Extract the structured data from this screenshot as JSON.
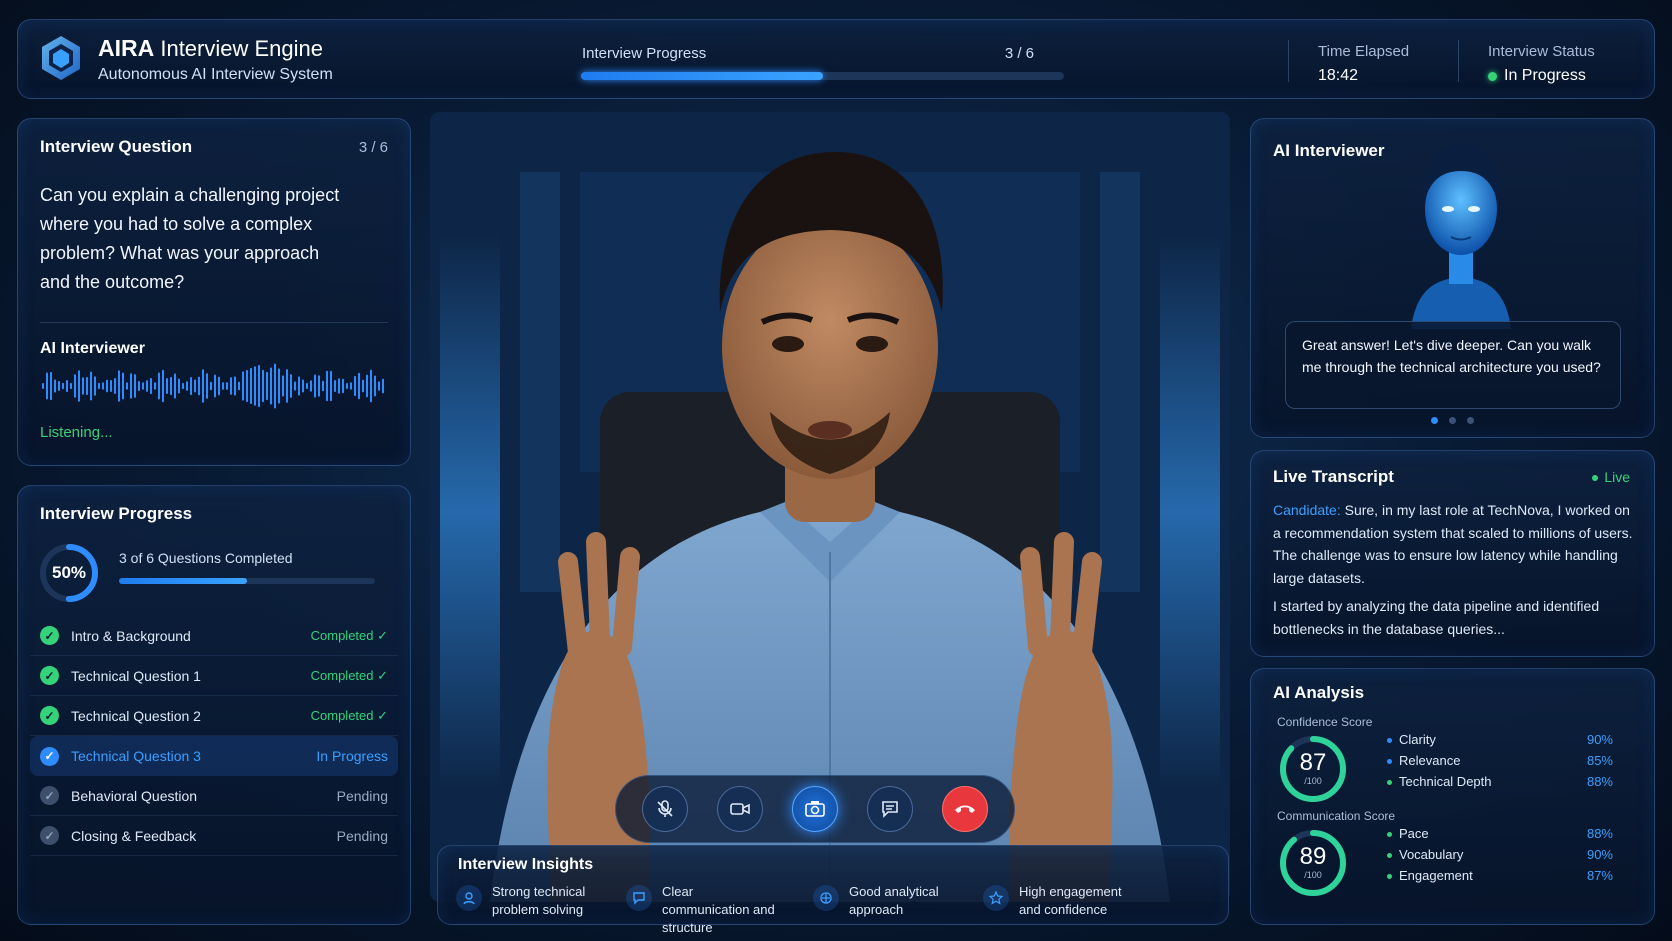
{
  "header": {
    "brand_strong": "AIRA",
    "brand_rest": " Interview Engine",
    "subtitle": "Autonomous AI Interview System",
    "progress_label": "Interview Progress",
    "progress_count": "3 / 6",
    "progress_fraction": 0.5,
    "time_label": "Time Elapsed",
    "time_value": "18:42",
    "status_label": "Interview Status",
    "status_value": "In Progress"
  },
  "question": {
    "title": "Interview Question",
    "count": "3 / 6",
    "text": "Can you explain a challenging project where you had to solve a complex problem? What was your approach and the outcome?",
    "ai_label": "AI Interviewer",
    "listening": "Listening..."
  },
  "progress": {
    "title": "Interview Progress",
    "percent": "50%",
    "percent_value": 50,
    "summary": "3 of 6 Questions Completed",
    "steps": [
      {
        "name": "Intro & Background",
        "status": "Completed ✓",
        "state": "done"
      },
      {
        "name": "Technical Question 1",
        "status": "Completed ✓",
        "state": "done"
      },
      {
        "name": "Technical Question 2",
        "status": "Completed ✓",
        "state": "done"
      },
      {
        "name": "Technical Question 3",
        "status": "In Progress",
        "state": "prog"
      },
      {
        "name": "Behavioral Question",
        "status": "Pending",
        "state": "pend"
      },
      {
        "name": "Closing & Feedback",
        "status": "Pending",
        "state": "pend"
      }
    ]
  },
  "controls": {
    "icons": [
      "microphone-icon",
      "video-camera-icon",
      "camera-capture-icon",
      "chat-icon",
      "end-call-icon"
    ],
    "end_color": "#e8383d",
    "accent_color": "#2f8cff"
  },
  "insights": {
    "title": "Interview Insights",
    "items": [
      {
        "text": "Strong technical problem solving",
        "icon": "user-icon"
      },
      {
        "text": "Clear communication and structure",
        "icon": "chat-icon"
      },
      {
        "text": "Good analytical approach",
        "icon": "brain-icon"
      },
      {
        "text": "High engagement and confidence",
        "icon": "star-icon"
      }
    ]
  },
  "ai_interviewer": {
    "title": "AI Interviewer",
    "message": "Great answer! Let's dive deeper. Can you walk me through the technical architecture you used?",
    "active_dot": 0
  },
  "transcript": {
    "title": "Live Transcript",
    "live": "Live",
    "speaker": "Candidate:",
    "para1": "Sure, in my last role at TechNova, I worked on a recommendation system that scaled to millions of users. The challenge was to ensure low latency while handling large datasets.",
    "para2": "I started by analyzing the data pipeline and identified bottlenecks in the database queries..."
  },
  "analysis": {
    "title": "AI Analysis",
    "confidence": {
      "label": "Confidence Score",
      "score": "87",
      "score_value": 87,
      "denominator": "/100",
      "metrics": [
        {
          "name": "Clarity",
          "value": "90%",
          "color": "#2f8cff"
        },
        {
          "name": "Relevance",
          "value": "85%",
          "color": "#2f8cff"
        },
        {
          "name": "Technical Depth",
          "value": "88%",
          "color": "#35d27a"
        }
      ]
    },
    "communication": {
      "label": "Communication Score",
      "score": "89",
      "score_value": 89,
      "denominator": "/100",
      "metrics": [
        {
          "name": "Pace",
          "value": "88%",
          "color": "#35d27a"
        },
        {
          "name": "Vocabulary",
          "value": "90%",
          "color": "#35d27a"
        },
        {
          "name": "Engagement",
          "value": "87%",
          "color": "#35d27a"
        }
      ]
    }
  }
}
